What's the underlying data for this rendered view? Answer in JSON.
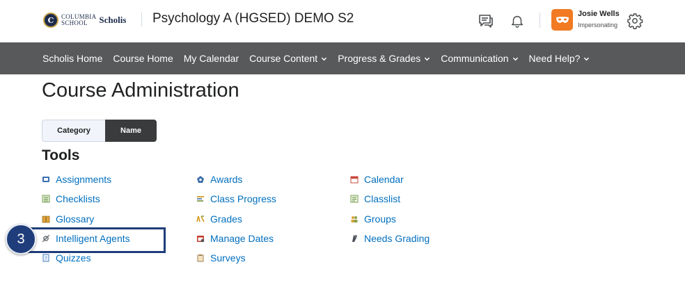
{
  "header": {
    "logo": {
      "seal_letter": "C",
      "line1": "COLUMBIA",
      "line2": "SCHOOL",
      "brand": "Scholis"
    },
    "course_title": "Psychology A (HGSED) DEMO S2",
    "user": {
      "name": "Josie Wells",
      "status": "Impersonating"
    }
  },
  "nav": {
    "items": [
      {
        "label": "Scholis Home",
        "dropdown": false
      },
      {
        "label": "Course Home",
        "dropdown": false
      },
      {
        "label": "My Calendar",
        "dropdown": false
      },
      {
        "label": "Course Content",
        "dropdown": true
      },
      {
        "label": "Progress & Grades",
        "dropdown": true
      },
      {
        "label": "Communication",
        "dropdown": true
      },
      {
        "label": "Need Help?",
        "dropdown": true
      }
    ]
  },
  "main": {
    "title": "Course Administration",
    "view_toggle": {
      "category": "Category",
      "name": "Name",
      "selected": "Name"
    },
    "section_title": "Tools",
    "tools": [
      {
        "label": "Assignments",
        "icon": "assignments-icon"
      },
      {
        "label": "Checklists",
        "icon": "checklist-icon"
      },
      {
        "label": "Glossary",
        "icon": "book-icon"
      },
      {
        "label": "Intelligent Agents",
        "icon": "agent-icon"
      },
      {
        "label": "Quizzes",
        "icon": "quiz-icon"
      },
      {
        "label": "Awards",
        "icon": "award-icon"
      },
      {
        "label": "Class Progress",
        "icon": "progress-icon"
      },
      {
        "label": "Grades",
        "icon": "grades-icon"
      },
      {
        "label": "Manage Dates",
        "icon": "manage-dates-icon"
      },
      {
        "label": "Surveys",
        "icon": "clipboard-icon"
      },
      {
        "label": "Calendar",
        "icon": "calendar-icon"
      },
      {
        "label": "Classlist",
        "icon": "classlist-icon"
      },
      {
        "label": "Groups",
        "icon": "groups-icon"
      },
      {
        "label": "Needs Grading",
        "icon": "needs-grading-icon"
      }
    ]
  },
  "annotation": {
    "step_number": "3",
    "highlight_target": "Intelligent Agents"
  },
  "colors": {
    "nav_bg": "#58595b",
    "link": "#006fbf",
    "avatar": "#f17a23",
    "annotation": "#1f3d7a"
  }
}
